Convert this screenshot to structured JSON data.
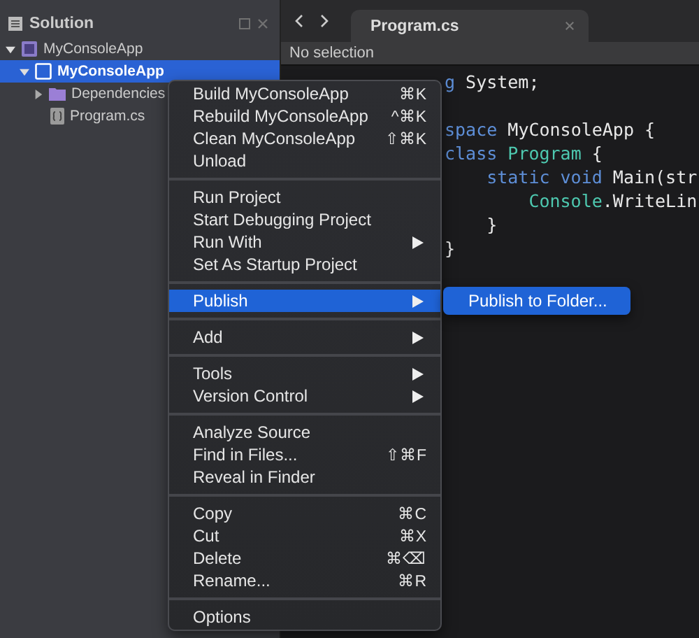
{
  "sidebar": {
    "title": "Solution",
    "tree": [
      {
        "label": "MyConsoleApp",
        "kind": "solution",
        "expanded": true,
        "selected": false,
        "children": [
          {
            "label": "MyConsoleApp",
            "kind": "project",
            "expanded": true,
            "selected": true,
            "children": [
              {
                "label": "Dependencies",
                "kind": "folder",
                "expanded": false,
                "selected": false
              },
              {
                "label": "Program.cs",
                "kind": "file",
                "selected": false
              }
            ]
          }
        ]
      }
    ]
  },
  "editor": {
    "tab": {
      "label": "Program.cs",
      "selected": true
    },
    "breadcrumb": "No selection",
    "code_lines": [
      {
        "tokens": [
          {
            "text": "g",
            "kind": "keyword"
          },
          {
            "text": " System;",
            "kind": "plain"
          }
        ]
      },
      {
        "gap_before": true,
        "tokens": [
          {
            "text": "space",
            "kind": "keyword"
          },
          {
            "text": " MyConsoleApp {",
            "kind": "plain"
          }
        ]
      },
      {
        "tokens": [
          {
            "text": "class",
            "kind": "keyword"
          },
          {
            "text": " Program",
            "kind": "type"
          },
          {
            "text": " {",
            "kind": "plain"
          }
        ]
      },
      {
        "tokens": [
          {
            "text": "    static void",
            "kind": "keyword"
          },
          {
            "text": " Main(str",
            "kind": "plain"
          }
        ]
      },
      {
        "tokens": [
          {
            "text": "        Console",
            "kind": "type"
          },
          {
            "text": ".WriteLin",
            "kind": "plain"
          }
        ]
      },
      {
        "tokens": [
          {
            "text": "    }",
            "kind": "plain"
          }
        ]
      },
      {
        "tokens": [
          {
            "text": "}",
            "kind": "plain"
          }
        ]
      }
    ]
  },
  "context_menu": {
    "groups": [
      [
        {
          "label": "Build MyConsoleApp",
          "shortcut": "⌘K",
          "submenu": false,
          "selected": false
        },
        {
          "label": "Rebuild MyConsoleApp",
          "shortcut": "^⌘K",
          "submenu": false,
          "selected": false
        },
        {
          "label": "Clean MyConsoleApp",
          "shortcut": "⇧⌘K",
          "submenu": false,
          "selected": false
        },
        {
          "label": "Unload",
          "submenu": false,
          "selected": false
        }
      ],
      [
        {
          "label": "Run Project",
          "submenu": false,
          "selected": false
        },
        {
          "label": "Start Debugging Project",
          "submenu": false,
          "selected": false
        },
        {
          "label": "Run With",
          "submenu": true,
          "selected": false
        },
        {
          "label": "Set As Startup Project",
          "submenu": false,
          "selected": false
        }
      ],
      [
        {
          "label": "Publish",
          "submenu": true,
          "selected": true
        }
      ],
      [
        {
          "label": "Add",
          "submenu": true,
          "selected": false
        }
      ],
      [
        {
          "label": "Tools",
          "submenu": true,
          "selected": false
        },
        {
          "label": "Version Control",
          "submenu": true,
          "selected": false
        }
      ],
      [
        {
          "label": "Analyze Source",
          "submenu": false,
          "selected": false
        },
        {
          "label": "Find in Files...",
          "shortcut": "⇧⌘F",
          "submenu": false,
          "selected": false
        },
        {
          "label": "Reveal in Finder",
          "submenu": false,
          "selected": false
        }
      ],
      [
        {
          "label": "Copy",
          "shortcut": "⌘C",
          "submenu": false,
          "selected": false
        },
        {
          "label": "Cut",
          "shortcut": "⌘X",
          "submenu": false,
          "selected": false
        },
        {
          "label": "Delete",
          "shortcut": "⌘⌫",
          "submenu": false,
          "selected": false
        },
        {
          "label": "Rename...",
          "shortcut": "⌘R",
          "submenu": false,
          "selected": false
        }
      ],
      [
        {
          "label": "Options",
          "submenu": false,
          "selected": false
        }
      ]
    ],
    "submenu": [
      {
        "label": "Publish to Folder...",
        "selected": true
      }
    ]
  }
}
